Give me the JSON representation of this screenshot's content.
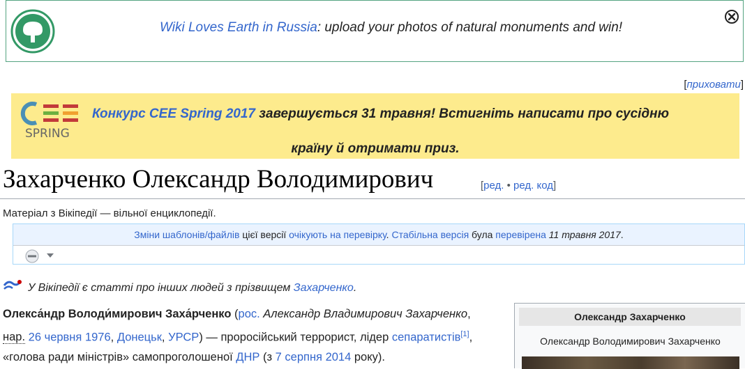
{
  "wle_banner": {
    "link": "Wiki Loves Earth in Russia",
    "text": ": upload your photos of natural monuments and win!",
    "accent": "#54a380"
  },
  "hide": {
    "open": "[",
    "link": "приховати",
    "close": "]"
  },
  "cee_banner": {
    "logo_text": "SPRING",
    "link": "Конкурс CEE Spring 2017",
    "text1": " завершується 31 травня! Встигніть написати про сусідню",
    "text2": "країну й отримати приз.",
    "background": "#fdeb8d"
  },
  "page": {
    "title": "Захарченко Олександр Володимирович",
    "edit_open": "[",
    "edit": "ред.",
    "edit_sep": " • ",
    "edit_code": "ред. код",
    "edit_close": "]",
    "subtitle": "Матеріал з Вікіпедії — вільної енциклопедії."
  },
  "review": {
    "l1": "Зміни шаблонів/файлів",
    "t1": " цієї версії ",
    "l2": "очікують на перевірку",
    "t2": ". ",
    "l3": "Стабільна версія",
    "t3": " була ",
    "l4": "перевірена",
    "t4": " 11 травня 2017",
    "t5": "."
  },
  "hatnote": {
    "text": "У Вікіпедії є статті про інших людей з прізвищем ",
    "link": "Захарченко",
    "end": "."
  },
  "lead": {
    "name": "Олекса́ндр Володи́мирович Заха́рченко",
    "p1": " (",
    "lang": "рос.",
    "ru_name": " Александр Владимирович Захарченко",
    "p2": ",",
    "born_abbr": "нар.",
    "sp": " ",
    "date": "26 червня 1976",
    "comma": ", ",
    "city": "Донецьк",
    "comma2": ", ",
    "country": "УРСР",
    "p3": ") — проросійський террорист, лідер ",
    "separ": "сепаратистів",
    "ref": "[1]",
    "p4": ",",
    "p5": "«голова ради міністрів» самопроголошеної ",
    "dnr": "ДНР",
    "p6": " (з ",
    "since": "7 серпня 2014",
    "p7": " року)."
  },
  "infobox": {
    "title": "Олександр Захарченко",
    "subtitle": "Олександр Володимирович Захарченко"
  }
}
